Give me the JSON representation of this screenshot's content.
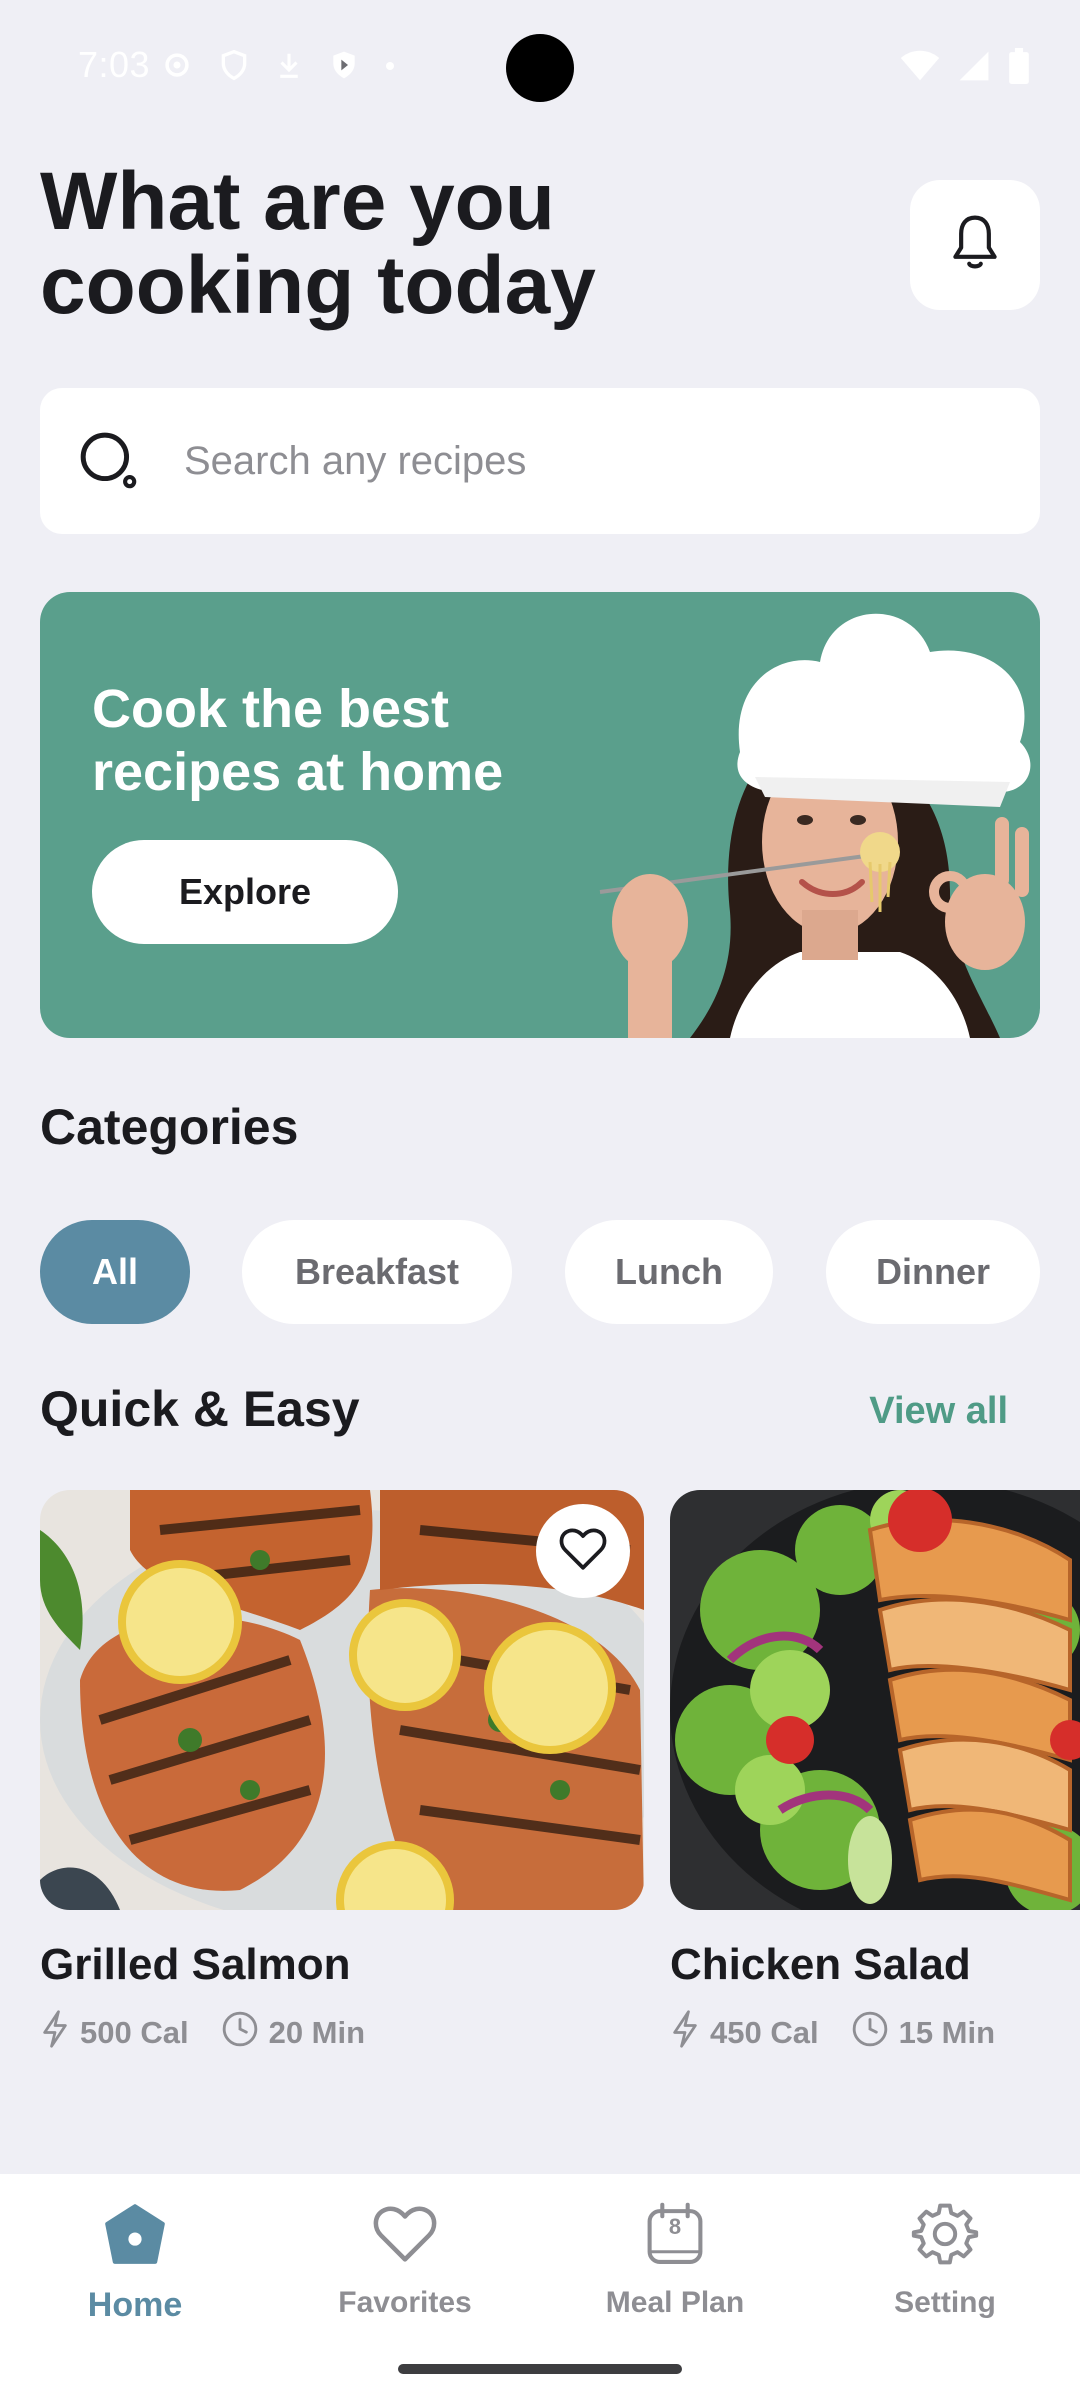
{
  "status_bar": {
    "time": "7:03",
    "icons_left": [
      "settings-icon",
      "shield-icon",
      "download-icon",
      "play-protect-icon",
      "dot-icon"
    ],
    "icons_right": [
      "wifi-icon",
      "signal-icon",
      "battery-icon"
    ]
  },
  "header": {
    "title": "What are you cooking today",
    "notification_icon": "bell-icon"
  },
  "search": {
    "placeholder": "Search any recipes",
    "value": ""
  },
  "banner": {
    "title": "Cook the best recipes at home",
    "button_label": "Explore",
    "background_color": "#5a9f8c"
  },
  "categories": {
    "title": "Categories",
    "items": [
      {
        "label": "All",
        "active": true
      },
      {
        "label": "Breakfast",
        "active": false
      },
      {
        "label": "Lunch",
        "active": false
      },
      {
        "label": "Dinner",
        "active": false
      }
    ],
    "active_color": "#5b8ba3"
  },
  "quick_easy": {
    "title": "Quick & Easy",
    "view_all_label": "View all",
    "recipes": [
      {
        "name": "Grilled Salmon",
        "calories": "500 Cal",
        "time": "20 Min",
        "favorite_icon": "heart-icon"
      },
      {
        "name": "Chicken Salad",
        "calories": "450 Cal",
        "time": "15 Min"
      }
    ]
  },
  "bottom_nav": {
    "items": [
      {
        "label": "Home",
        "icon": "home-icon",
        "active": true
      },
      {
        "label": "Favorites",
        "icon": "heart-icon",
        "active": false
      },
      {
        "label": "Meal Plan",
        "icon": "calendar-icon",
        "badge": "8",
        "active": false
      },
      {
        "label": "Setting",
        "icon": "gear-icon",
        "active": false
      }
    ]
  }
}
